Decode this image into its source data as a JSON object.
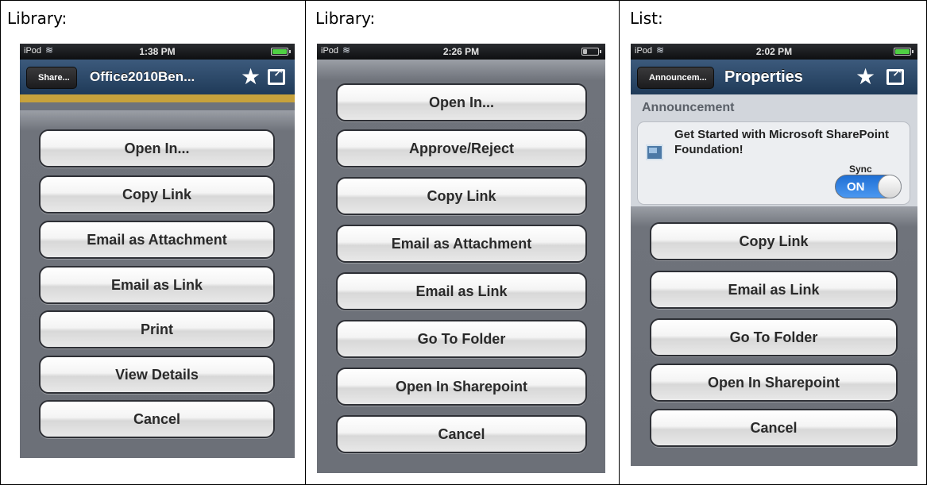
{
  "columns": [
    {
      "label": "Library:",
      "status": {
        "carrier": "iPod",
        "time": "1:38 PM"
      },
      "nav": {
        "back": "Share...",
        "title": "Office2010Ben..."
      },
      "buttons": [
        "Open In...",
        "Copy Link",
        "Email as Attachment",
        "Email as Link",
        "Print",
        "View Details",
        "Cancel"
      ]
    },
    {
      "label": "Library:",
      "status": {
        "carrier": "iPod",
        "time": "2:26 PM"
      },
      "buttons": [
        "Open In...",
        "Approve/Reject",
        "Copy Link",
        "Email as Attachment",
        "Email as Link",
        "Go To Folder",
        "Open In Sharepoint",
        "Cancel"
      ]
    },
    {
      "label": "List:",
      "status": {
        "carrier": "iPod",
        "time": "2:02 PM"
      },
      "nav": {
        "back": "Announcem...",
        "title": "Properties"
      },
      "section": "Announcement",
      "card_title": "Get Started with Microsoft SharePoint Foundation!",
      "sync_label": "Sync",
      "toggle_label": "ON",
      "buttons": [
        "Copy Link",
        "Email as Link",
        "Go To Folder",
        "Open In Sharepoint",
        "Cancel"
      ]
    }
  ]
}
